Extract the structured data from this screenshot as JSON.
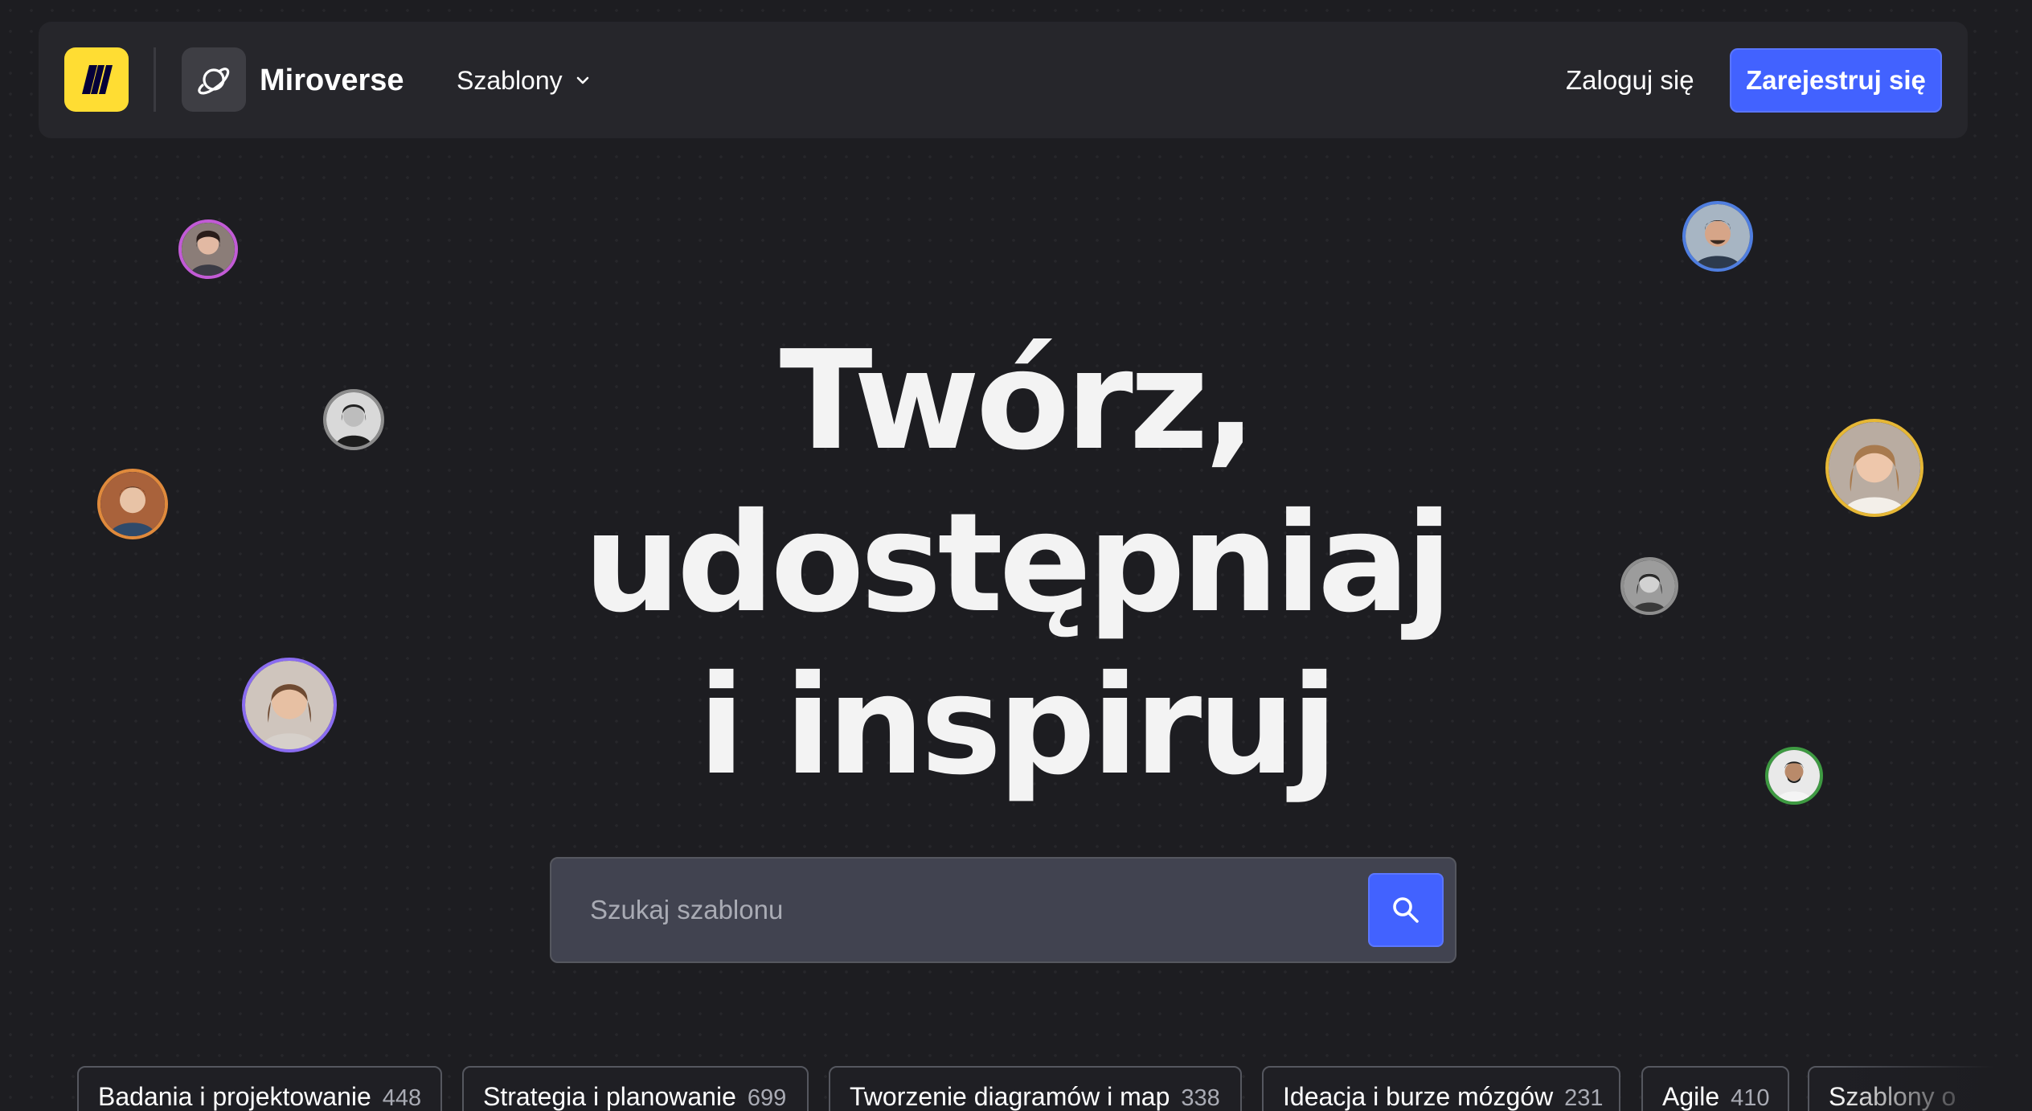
{
  "header": {
    "brand_name": "Miroverse",
    "templates_menu_label": "Szablony",
    "login_label": "Zaloguj się",
    "signup_label": "Zarejestruj się"
  },
  "hero": {
    "title_lines": [
      "Twórz,",
      "udostępniaj",
      "i inspiruj"
    ]
  },
  "search": {
    "placeholder": "Szukaj szablonu"
  },
  "categories": [
    {
      "label": "Badania i projektowanie",
      "count": "448"
    },
    {
      "label": "Strategia i planowanie",
      "count": "699"
    },
    {
      "label": "Tworzenie diagramów i map",
      "count": "338"
    },
    {
      "label": "Ideacja i burze mózgów",
      "count": "231"
    },
    {
      "label": "Agile",
      "count": "410"
    },
    {
      "label": "Szablony o",
      "count": ""
    }
  ],
  "colors": {
    "background": "#1d1d21",
    "navbar": "#26262b",
    "accent": "#4262ff",
    "miro_yellow": "#ffdd33",
    "search_field": "#414350"
  },
  "icons": {
    "logo": "miro-logo-icon",
    "brand": "planet-icon",
    "menu": "chevron-down-icon",
    "search": "search-icon"
  }
}
